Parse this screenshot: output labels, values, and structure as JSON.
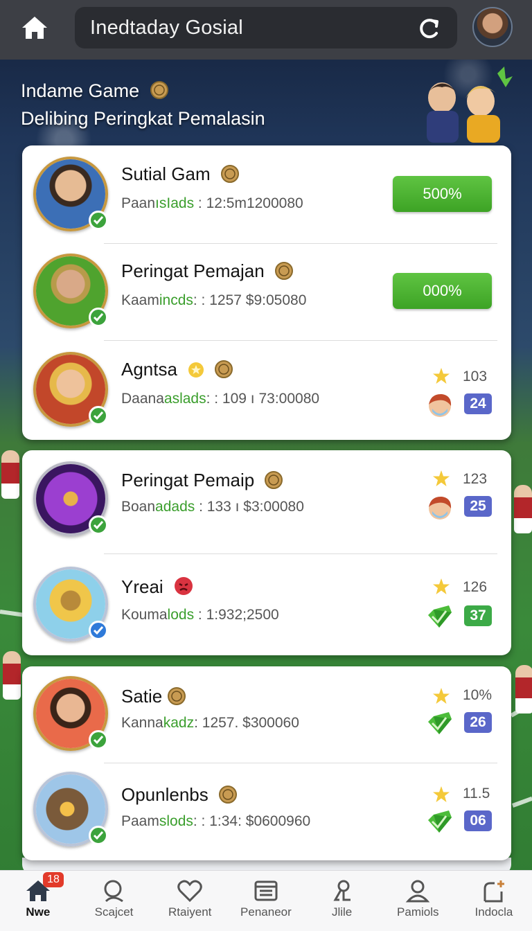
{
  "header": {
    "search_text": "Inedtaday Gosial"
  },
  "hero": {
    "line1": "Indame Game",
    "line2": "Delibing Peringkat Pemalasin"
  },
  "players": [
    {
      "name": "Sutial Gam",
      "sub_a": "Paan",
      "sub_hl": "ısIads",
      "sub_b": " : 12:5m1200080",
      "percent": "500%"
    },
    {
      "name": "Peringat Pemajan",
      "sub_a": "Kaam",
      "sub_hl": "incds",
      "sub_b": ": : 1257  $9:05080",
      "percent": "000%"
    },
    {
      "name": "Agntsa",
      "sub_a": "Daana",
      "sub_hl": "aslads",
      "sub_b": ": : 109 ı 73:00080",
      "stat": "103",
      "badge": "24"
    },
    {
      "name": "Peringat Pemaip",
      "sub_a": "Boan",
      "sub_hl": "adads",
      "sub_b": " : 133 ı $3:00080",
      "stat": "123",
      "badge": "25"
    },
    {
      "name": "Yreai",
      "sub_a": "Kouma",
      "sub_hl": "lods",
      "sub_b": " : 1:932;2500",
      "stat": "126",
      "badge": "37"
    },
    {
      "name": "Satie",
      "sub_a": "Kanna",
      "sub_hl": "kadz",
      "sub_b": ": 1257. $300060",
      "stat": "10%",
      "badge": "26"
    },
    {
      "name": "Opunlenbs",
      "sub_a": "Paam",
      "sub_hl": "slods",
      "sub_b": ": : 1:34: $0600960",
      "stat": "11.5",
      "badge": "06"
    }
  ],
  "nav": {
    "items": [
      {
        "label": "Nwe",
        "badge": "18"
      },
      {
        "label": "Scajcet"
      },
      {
        "label": "Rtaiyent"
      },
      {
        "label": "Penaneor"
      },
      {
        "label": "Jlile"
      },
      {
        "label": "Pamiols"
      },
      {
        "label": "Indocla"
      }
    ]
  },
  "colors": {
    "top_bar": "#3d3f45",
    "accent_green": "#3da325",
    "badge_purple": "#5a67c9",
    "badge_green": "#3caa47",
    "nav_badge_red": "#e23a2a"
  }
}
